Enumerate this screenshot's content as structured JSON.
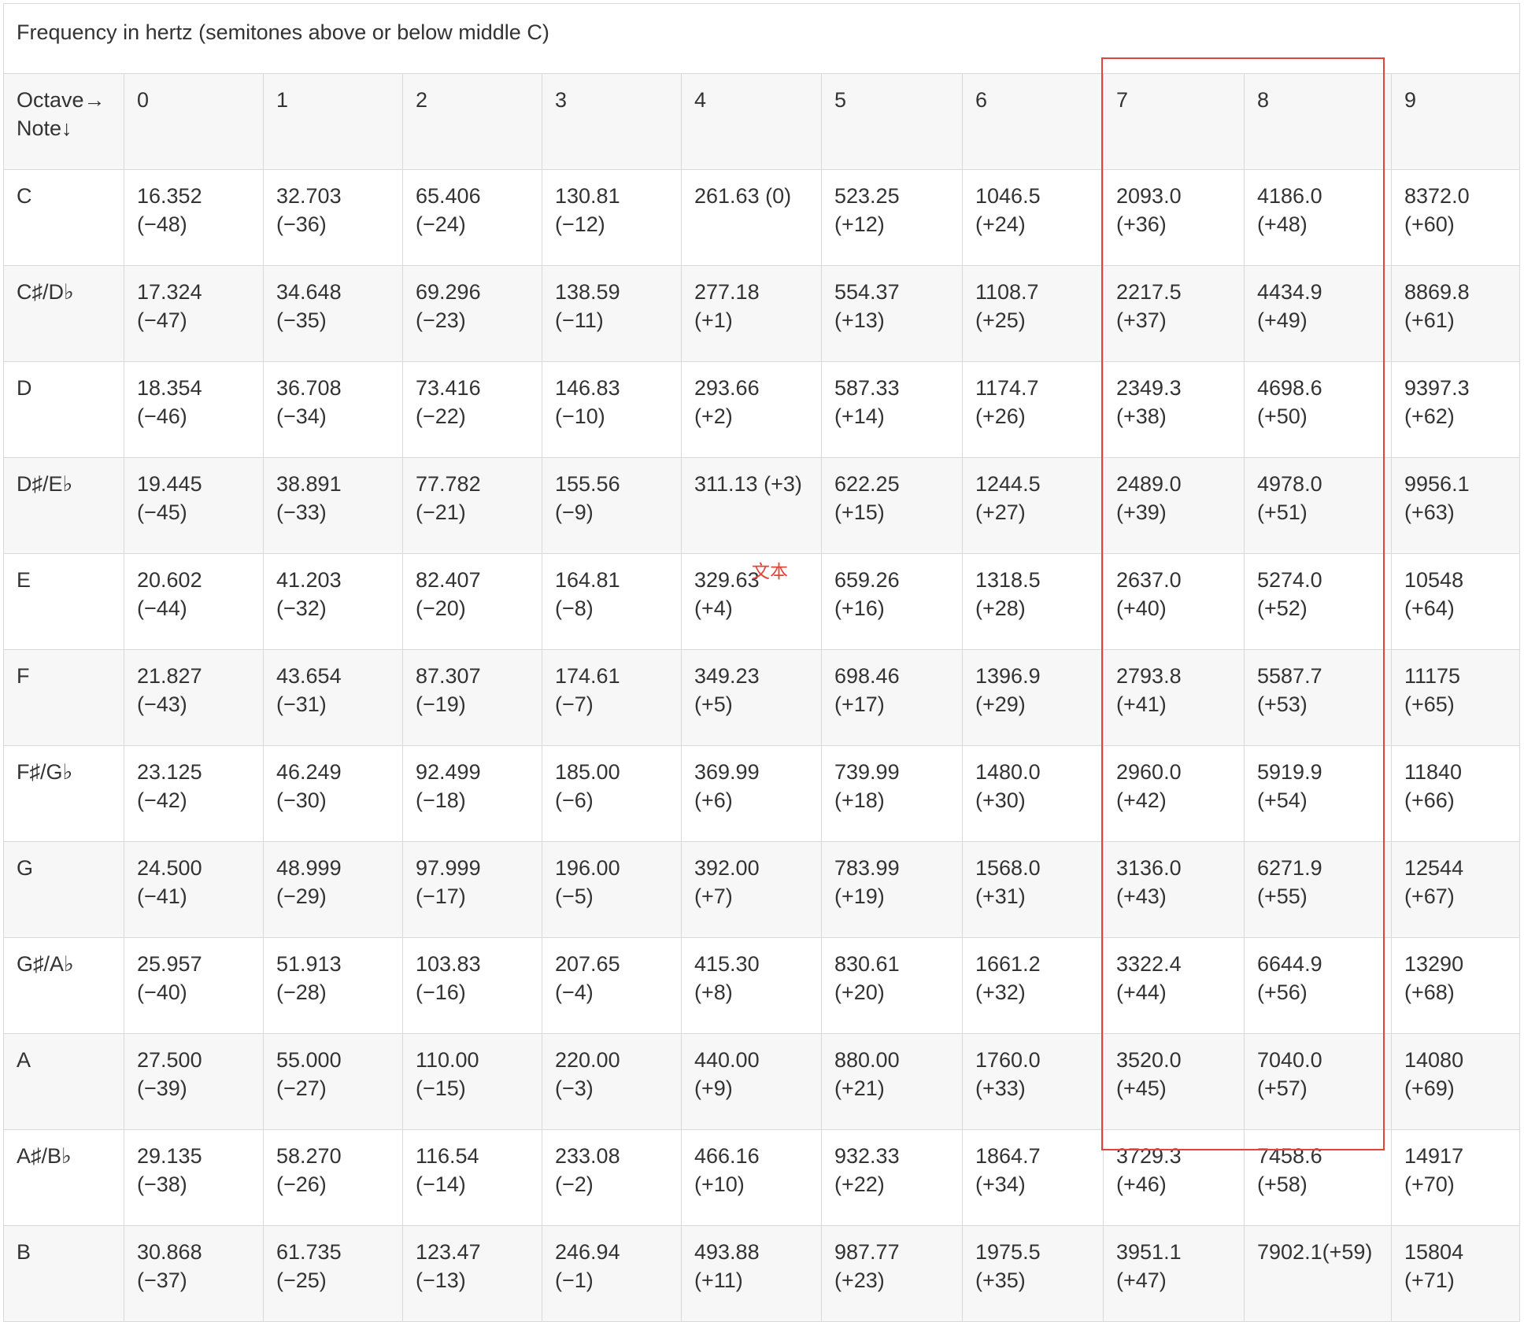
{
  "table": {
    "caption": "Frequency in hertz (semitones above or below middle C)",
    "corner_header": [
      "Octave→",
      "Note↓"
    ],
    "octaves": [
      "0",
      "1",
      "2",
      "3",
      "4",
      "5",
      "6",
      "7",
      "8",
      "9"
    ],
    "rows": [
      {
        "note": "C",
        "cells": [
          [
            "16.352",
            "(−48)"
          ],
          [
            "32.703",
            "(−36)"
          ],
          [
            "65.406",
            "(−24)"
          ],
          [
            "130.81",
            "(−12)"
          ],
          [
            "261.63 (0)"
          ],
          [
            "523.25",
            "(+12)"
          ],
          [
            "1046.5",
            "(+24)"
          ],
          [
            "2093.0",
            "(+36)"
          ],
          [
            "4186.0",
            "(+48)"
          ],
          [
            "8372.0",
            "(+60)"
          ]
        ]
      },
      {
        "note": "C♯/D♭",
        "cells": [
          [
            "17.324",
            "(−47)"
          ],
          [
            "34.648",
            "(−35)"
          ],
          [
            "69.296",
            "(−23)"
          ],
          [
            "138.59",
            "(−11)"
          ],
          [
            "277.18",
            "(+1)"
          ],
          [
            "554.37",
            "(+13)"
          ],
          [
            "1108.7",
            "(+25)"
          ],
          [
            "2217.5",
            "(+37)"
          ],
          [
            "4434.9",
            "(+49)"
          ],
          [
            "8869.8",
            "(+61)"
          ]
        ]
      },
      {
        "note": "D",
        "cells": [
          [
            "18.354",
            "(−46)"
          ],
          [
            "36.708",
            "(−34)"
          ],
          [
            "73.416",
            "(−22)"
          ],
          [
            "146.83",
            "(−10)"
          ],
          [
            "293.66",
            "(+2)"
          ],
          [
            "587.33",
            "(+14)"
          ],
          [
            "1174.7",
            "(+26)"
          ],
          [
            "2349.3",
            "(+38)"
          ],
          [
            "4698.6",
            "(+50)"
          ],
          [
            "9397.3",
            "(+62)"
          ]
        ]
      },
      {
        "note": "D♯/E♭",
        "cells": [
          [
            "19.445",
            "(−45)"
          ],
          [
            "38.891",
            "(−33)"
          ],
          [
            "77.782",
            "(−21)"
          ],
          [
            "155.56",
            "(−9)"
          ],
          [
            "311.13 (+3)"
          ],
          [
            "622.25",
            "(+15)"
          ],
          [
            "1244.5",
            "(+27)"
          ],
          [
            "2489.0",
            "(+39)"
          ],
          [
            "4978.0",
            "(+51)"
          ],
          [
            "9956.1",
            "(+63)"
          ]
        ]
      },
      {
        "note": "E",
        "cells": [
          [
            "20.602",
            "(−44)"
          ],
          [
            "41.203",
            "(−32)"
          ],
          [
            "82.407",
            "(−20)"
          ],
          [
            "164.81",
            "(−8)"
          ],
          [
            "329.63",
            "(+4)"
          ],
          [
            "659.26",
            "(+16)"
          ],
          [
            "1318.5",
            "(+28)"
          ],
          [
            "2637.0",
            "(+40)"
          ],
          [
            "5274.0",
            "(+52)"
          ],
          [
            "10548",
            "(+64)"
          ]
        ]
      },
      {
        "note": "F",
        "cells": [
          [
            "21.827",
            "(−43)"
          ],
          [
            "43.654",
            "(−31)"
          ],
          [
            "87.307",
            "(−19)"
          ],
          [
            "174.61",
            "(−7)"
          ],
          [
            "349.23",
            "(+5)"
          ],
          [
            "698.46",
            "(+17)"
          ],
          [
            "1396.9",
            "(+29)"
          ],
          [
            "2793.8",
            "(+41)"
          ],
          [
            "5587.7",
            "(+53)"
          ],
          [
            "11175",
            "(+65)"
          ]
        ]
      },
      {
        "note": "F♯/G♭",
        "cells": [
          [
            "23.125",
            "(−42)"
          ],
          [
            "46.249",
            "(−30)"
          ],
          [
            "92.499",
            "(−18)"
          ],
          [
            "185.00",
            "(−6)"
          ],
          [
            "369.99",
            "(+6)"
          ],
          [
            "739.99",
            "(+18)"
          ],
          [
            "1480.0",
            "(+30)"
          ],
          [
            "2960.0",
            "(+42)"
          ],
          [
            "5919.9",
            "(+54)"
          ],
          [
            "11840",
            "(+66)"
          ]
        ]
      },
      {
        "note": "G",
        "cells": [
          [
            "24.500",
            "(−41)"
          ],
          [
            "48.999",
            "(−29)"
          ],
          [
            "97.999",
            "(−17)"
          ],
          [
            "196.00",
            "(−5)"
          ],
          [
            "392.00",
            "(+7)"
          ],
          [
            "783.99",
            "(+19)"
          ],
          [
            "1568.0",
            "(+31)"
          ],
          [
            "3136.0",
            "(+43)"
          ],
          [
            "6271.9",
            "(+55)"
          ],
          [
            "12544",
            "(+67)"
          ]
        ]
      },
      {
        "note": "G♯/A♭",
        "cells": [
          [
            "25.957",
            "(−40)"
          ],
          [
            "51.913",
            "(−28)"
          ],
          [
            "103.83",
            "(−16)"
          ],
          [
            "207.65",
            "(−4)"
          ],
          [
            "415.30",
            "(+8)"
          ],
          [
            "830.61",
            "(+20)"
          ],
          [
            "1661.2",
            "(+32)"
          ],
          [
            "3322.4",
            "(+44)"
          ],
          [
            "6644.9",
            "(+56)"
          ],
          [
            "13290",
            "(+68)"
          ]
        ]
      },
      {
        "note": "A",
        "cells": [
          [
            "27.500",
            "(−39)"
          ],
          [
            "55.000",
            "(−27)"
          ],
          [
            "110.00",
            "(−15)"
          ],
          [
            "220.00",
            "(−3)"
          ],
          [
            "440.00",
            "(+9)"
          ],
          [
            "880.00",
            "(+21)"
          ],
          [
            "1760.0",
            "(+33)"
          ],
          [
            "3520.0",
            "(+45)"
          ],
          [
            "7040.0",
            "(+57)"
          ],
          [
            "14080",
            "(+69)"
          ]
        ]
      },
      {
        "note": "A♯/B♭",
        "cells": [
          [
            "29.135",
            "(−38)"
          ],
          [
            "58.270",
            "(−26)"
          ],
          [
            "116.54",
            "(−14)"
          ],
          [
            "233.08",
            "(−2)"
          ],
          [
            "466.16",
            "(+10)"
          ],
          [
            "932.33",
            "(+22)"
          ],
          [
            "1864.7",
            "(+34)"
          ],
          [
            "3729.3",
            "(+46)"
          ],
          [
            "7458.6",
            "(+58)"
          ],
          [
            "14917",
            "(+70)"
          ]
        ]
      },
      {
        "note": "B",
        "cells": [
          [
            "30.868",
            "(−37)"
          ],
          [
            "61.735",
            "(−25)"
          ],
          [
            "123.47",
            "(−13)"
          ],
          [
            "246.94",
            "(−1)"
          ],
          [
            "493.88",
            "(+11)"
          ],
          [
            "987.77",
            "(+23)"
          ],
          [
            "1975.5",
            "(+35)"
          ],
          [
            "3951.1",
            "(+47)"
          ],
          [
            "7902.1(+59)"
          ],
          [
            "15804",
            "(+71)"
          ]
        ]
      }
    ]
  },
  "annotation": {
    "label": "文本",
    "color": "#e0443a"
  }
}
